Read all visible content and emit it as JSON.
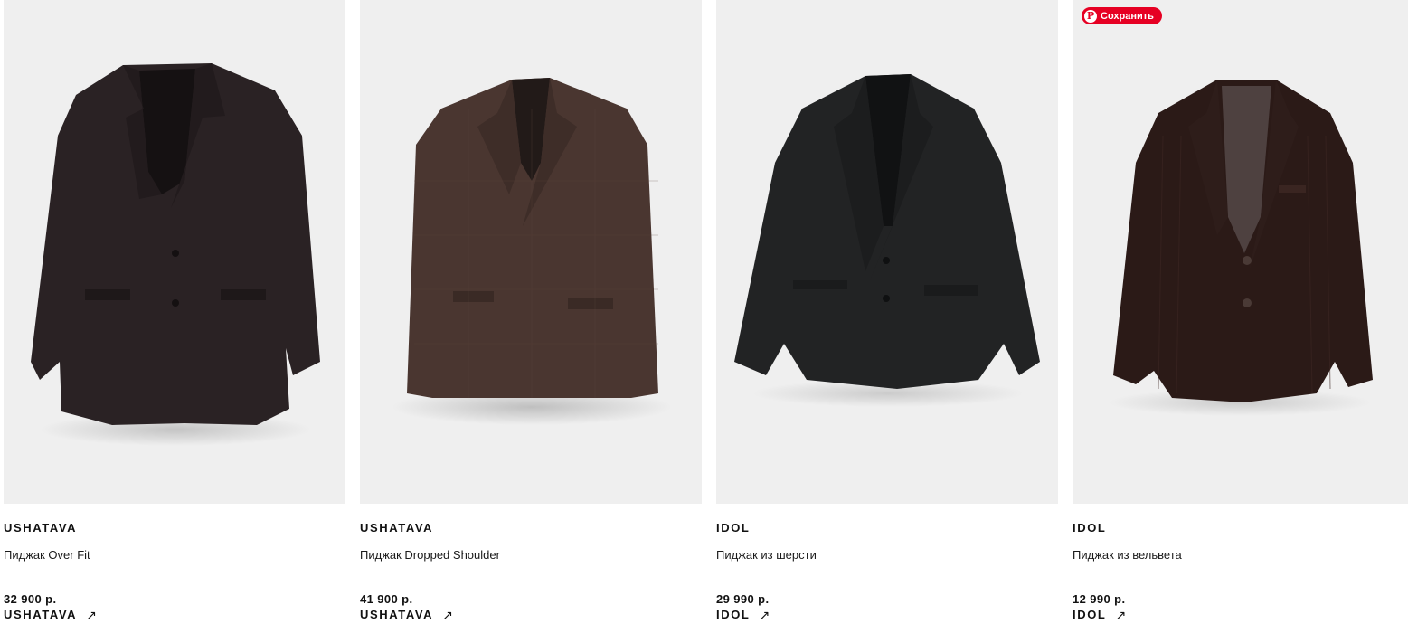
{
  "products": [
    {
      "brand": "USHATAVA",
      "name": "Пиджак Over Fit",
      "price": "32 900 р.",
      "shop_label": "USHATAVA",
      "image_icon": "jacket-image"
    },
    {
      "brand": "USHATAVA",
      "name": "Пиджак Dropped Shoulder",
      "price": "41 900 р.",
      "shop_label": "USHATAVA",
      "image_icon": "jacket-image"
    },
    {
      "brand": "IDOL",
      "name": "Пиджак из шерсти",
      "price": "29 990 р.",
      "shop_label": "IDOL",
      "image_icon": "jacket-image"
    },
    {
      "brand": "IDOL",
      "name": "Пиджак из вельвета",
      "price": "12 990 р.",
      "shop_label": "IDOL",
      "image_icon": "jacket-image"
    }
  ],
  "pinterest": {
    "save_label": "Сохранить",
    "logo_glyph": "P",
    "color": "#e60023"
  },
  "arrow_glyph": "↗",
  "colors": {
    "image_bg": "#efefef",
    "text": "#111111"
  }
}
